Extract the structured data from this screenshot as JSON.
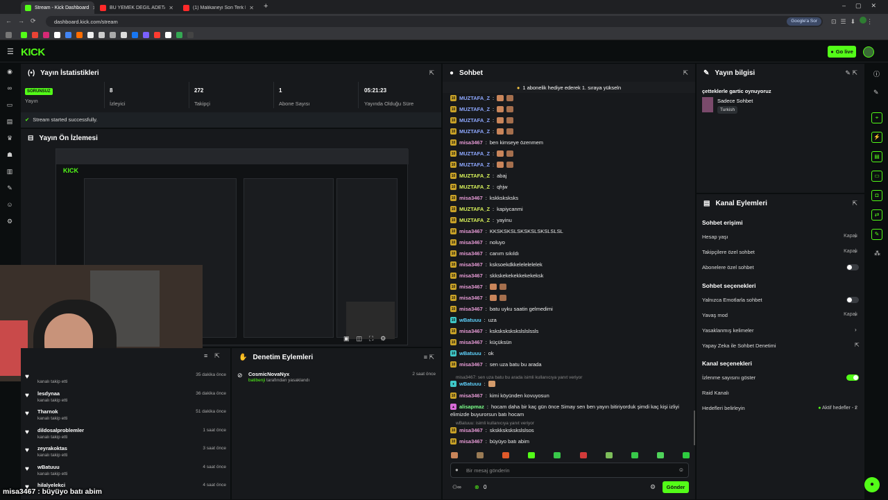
{
  "browser": {
    "tabs": [
      {
        "label": "Stream - Kick Dashboard",
        "color": "#53fc18"
      },
      {
        "label": "BU YEMEK DEĞİL ADETA ŞÖLEN",
        "color": "#ff2a2a"
      },
      {
        "label": "(1) Malikaneyi Son Terk Eden K",
        "color": "#ff2a2a"
      }
    ],
    "url": "dashboard.kick.com/stream",
    "google_label": "Google'a Sor"
  },
  "app": {
    "logo": "KICK",
    "go_live_label": "Go live",
    "accent": "#53fc18"
  },
  "stats": {
    "title": "Yayın İstatistikleri",
    "status_badge": "SORUNSUZ",
    "status_label": "Yayın",
    "viewers_value": "8",
    "viewers_label": "İzleyici",
    "followers_value": "272",
    "followers_label": "Takipçi",
    "subs_value": "1",
    "subs_label": "Abone Sayısı",
    "duration_value": "05:21:23",
    "duration_label": "Yayında Olduğu Süre",
    "success_msg": "Stream started successfully."
  },
  "preview": {
    "title": "Yayın Ön İzlemesi"
  },
  "follows": {
    "items": [
      {
        "name": "",
        "sub": "kanalı takip etti",
        "time": "35 dakika önce"
      },
      {
        "name": "lesdynaa",
        "sub": "kanalı takip etti",
        "time": "36 dakika önce"
      },
      {
        "name": "Tharnok",
        "sub": "kanalı takip etti",
        "time": "51 dakika önce"
      },
      {
        "name": "dildosalproblemler",
        "sub": "kanalı takip etti",
        "time": "1 saat önce"
      },
      {
        "name": "zeyrakoktas",
        "sub": "kanalı takip etti",
        "time": "3 saat önce"
      },
      {
        "name": "wBatuuu",
        "sub": "kanalı takip etti",
        "time": "4 saat önce"
      },
      {
        "name": "hilalyelekci",
        "sub": "",
        "time": "4 saat önce"
      }
    ]
  },
  "mod_actions": {
    "title": "Denetim Eylemleri",
    "user": "CosmicNovaNyx",
    "actor": "batibenji",
    "action": "tarafından yasaklandı",
    "time": "2 saat önce"
  },
  "chat": {
    "title": "Sohbet",
    "pinned": "1 abonelik hediye ederek 1. sıraya yükseln",
    "messages": [
      {
        "user": "MUZTAFA_Z",
        "text": "",
        "c": "muz",
        "emo": true
      },
      {
        "user": "MUZTAFA_Z",
        "text": "",
        "c": "muz",
        "emo": true
      },
      {
        "user": "MUZTAFA_Z",
        "text": "",
        "c": "muz",
        "emo": true
      },
      {
        "user": "MUZTAFA_Z",
        "text": "",
        "c": "muz",
        "emo": true
      },
      {
        "user": "misa3467",
        "text": "ben kimseye özenmem",
        "c": "misa"
      },
      {
        "user": "MUZTAFA_Z",
        "text": "",
        "c": "muz",
        "emo": true
      },
      {
        "user": "MUZTAFA_Z",
        "text": "",
        "c": "muz",
        "emo": true
      },
      {
        "user": "MUZTAFA_Z",
        "text": "abaj",
        "c": "mz2"
      },
      {
        "user": "MUZTAFA_Z",
        "text": "qhjw",
        "c": "mz2"
      },
      {
        "user": "misa3467",
        "text": "kskksksksks",
        "c": "misa"
      },
      {
        "user": "MUZTAFA_Z",
        "text": "kapiycanmi",
        "c": "mz2"
      },
      {
        "user": "MUZTAFA_Z",
        "text": "yayinu",
        "c": "mz2"
      },
      {
        "user": "misa3467",
        "text": "KKSKSKSLSKSKSLSKSLSLSL",
        "c": "misa"
      },
      {
        "user": "misa3467",
        "text": "noluyo",
        "c": "misa"
      },
      {
        "user": "misa3467",
        "text": "canım sıkıldı",
        "c": "misa"
      },
      {
        "user": "misa3467",
        "text": "ksksoekdkkelelelelelek",
        "c": "misa"
      },
      {
        "user": "misa3467",
        "text": "skkskekekekkekekeksk",
        "c": "misa"
      },
      {
        "user": "misa3467",
        "text": "",
        "c": "misa",
        "emo": true
      },
      {
        "user": "misa3467",
        "text": "",
        "c": "misa",
        "emo": true
      },
      {
        "user": "misa3467",
        "text": "batu uyku saatin gelmedimi",
        "c": "misa"
      },
      {
        "user": "wBatuuu",
        "text": "uza",
        "c": "wb"
      },
      {
        "user": "misa3467",
        "text": "kskskskskskslslslssls",
        "c": "misa"
      },
      {
        "user": "misa3467",
        "text": "küçüksün",
        "c": "misa"
      },
      {
        "user": "wBatuuu",
        "text": "ok",
        "c": "wb"
      },
      {
        "user": "misa3467",
        "text": "sen uza batu bu arada",
        "c": "misa"
      }
    ],
    "reply1": "misa3467: sen uza batu bu arada isimli kullanıcıya yanıt veriyor",
    "msg_after1_user": "wBatuuu",
    "msg_after2_user": "misa3467",
    "msg_after2_text": "kimi köyünden kovuyosun",
    "long_user": "alisapmaz",
    "long_text1": "hocam daha bir kaç gün önce Simay sen ben yayın bitiriyorduk şimdi kaç kişi izliyi",
    "long_text2": "elimizde buyurorsun batı hocam",
    "reply2": "wBatuuu: isimli kullanıcıya yanıt veriyor",
    "msg_last1_user": "misa3467",
    "msg_last1_text": "skskkskskskslslsos",
    "msg_last2_user": "misa3467",
    "msg_last2_text": "büyüyo batı abim",
    "input_placeholder": "Bir mesaj gönderin",
    "send_label": "Gönder",
    "points_label": "0"
  },
  "info": {
    "title": "Yayın bilgisi",
    "stream_title": "çetteklerle gartic oynuyoruz",
    "category": "Sadece Sohbet",
    "language": "Turkish"
  },
  "actions": {
    "title": "Kanal Eylemleri",
    "chat_access": "Sohbet erişimi",
    "account_age": "Hesap yaşı",
    "account_age_val": "Kapalı",
    "followers_only": "Takipçilere özel sohbet",
    "followers_only_val": "Kapalı",
    "subs_only": "Abonelere özel sohbet",
    "chat_options": "Sohbet seçenekleri",
    "emotes_only": "Yalnızca Emotlarla sohbet",
    "slow_mode": "Yavaş mod",
    "slow_mode_val": "Kapalı",
    "banned_words": "Yasaklanmış kelimeler",
    "ai_mod": "Yapay Zeka ile Sohbet Denetimi",
    "channel_options": "Kanal seçenekleri",
    "show_viewers": "İzlenme sayısını göster",
    "raid": "Raid Kanalı",
    "goals": "Hedefleri belirleyin",
    "goals_val": "Aktif hedefler - 2"
  },
  "overlay_caption": "misa3467 : büyüyo batı abim"
}
